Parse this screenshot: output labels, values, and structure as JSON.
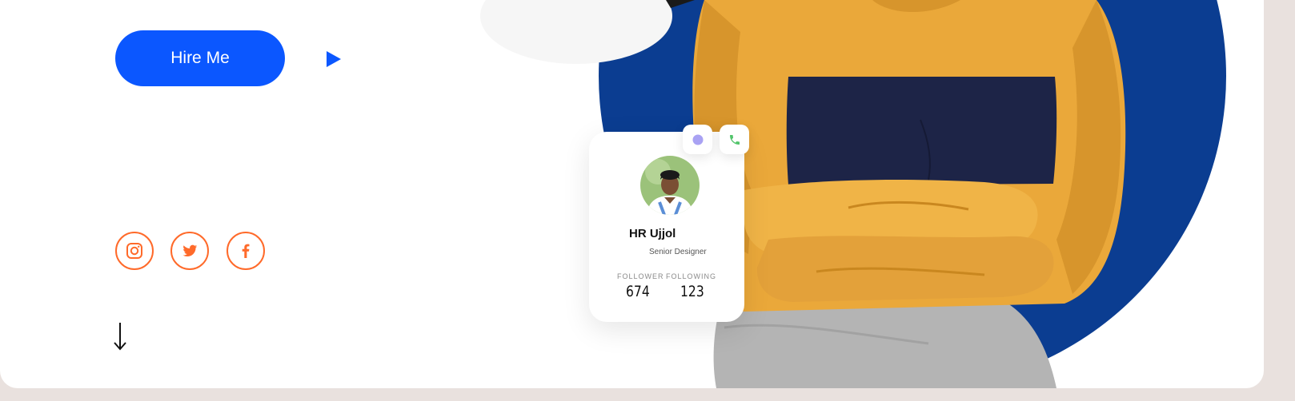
{
  "hero": {
    "hire_button_label": "Hire Me",
    "play_icon": "play-icon",
    "scroll_icon": "arrow-down-icon",
    "accent_color": "#0b57ff",
    "social_color": "#ff6a2a",
    "social_links": [
      {
        "name": "instagram",
        "icon": "instagram-icon"
      },
      {
        "name": "twitter",
        "icon": "twitter-icon"
      },
      {
        "name": "facebook",
        "icon": "facebook-icon"
      }
    ]
  },
  "profile_card": {
    "name": "HR Ujjol",
    "role": "Senior Designer",
    "follower_label": "FOLLOWER",
    "follower_count": "674",
    "following_label": "FOLLOWING",
    "following_count": "123",
    "actions": [
      {
        "icon": "chat-dot-icon",
        "color": "#a9a2f3"
      },
      {
        "icon": "phone-icon",
        "color": "#52c46b"
      }
    ]
  },
  "colors": {
    "sweater_yellow": "#eaa83a",
    "sweater_navy": "#1d2447",
    "circle_blue": "#0b3d91"
  }
}
